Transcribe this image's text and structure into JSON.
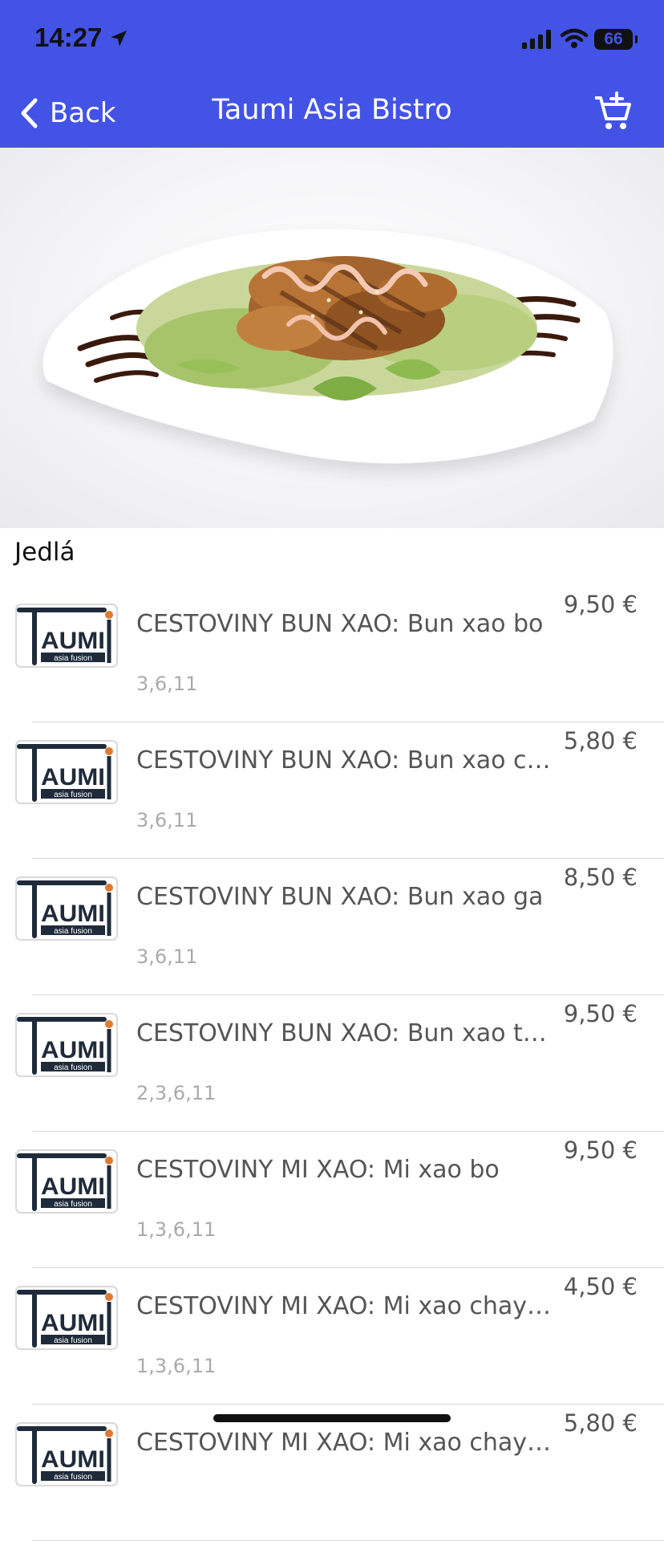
{
  "status_bar": {
    "time": "14:27",
    "battery": "66"
  },
  "nav": {
    "back_label": "Back",
    "title": "Taumi Asia Bistro"
  },
  "section": {
    "title": "Jedlá"
  },
  "logo": {
    "brand_text": "AUMI",
    "tagline": "asia fusion"
  },
  "menu_items": [
    {
      "name": "CESTOVINY BUN XAO: Bun xao bo",
      "price": "9,50 €",
      "allergens": "3,6,11"
    },
    {
      "name": "CESTOVINY BUN XAO: Bun xao chay",
      "price": "5,80 €",
      "allergens": "3,6,11"
    },
    {
      "name": "CESTOVINY BUN XAO: Bun xao ga",
      "price": "8,50 €",
      "allergens": "3,6,11"
    },
    {
      "name": "CESTOVINY BUN XAO: Bun xao tom",
      "price": "9,50 €",
      "allergens": "2,3,6,11"
    },
    {
      "name": "CESTOVINY MI XAO: Mi xao bo",
      "price": "9,50 €",
      "allergens": "1,3,6,11"
    },
    {
      "name": "CESTOVINY MI XAO: Mi xao chay Novi...",
      "price": "4,50 €",
      "allergens": "1,3,6,11"
    },
    {
      "name": "CESTOVINY MI XAO: Mi xao chay Novi...",
      "price": "5,80 €",
      "allergens": ""
    }
  ],
  "colors": {
    "header": "#4353e6",
    "logo_dark": "#1f2b3a",
    "logo_accent": "#e07a2f"
  },
  "icons": {
    "location": "location-arrow-icon",
    "signal": "cellular-signal-icon",
    "wifi": "wifi-icon",
    "back": "chevron-left-icon",
    "cart": "cart-add-icon"
  }
}
